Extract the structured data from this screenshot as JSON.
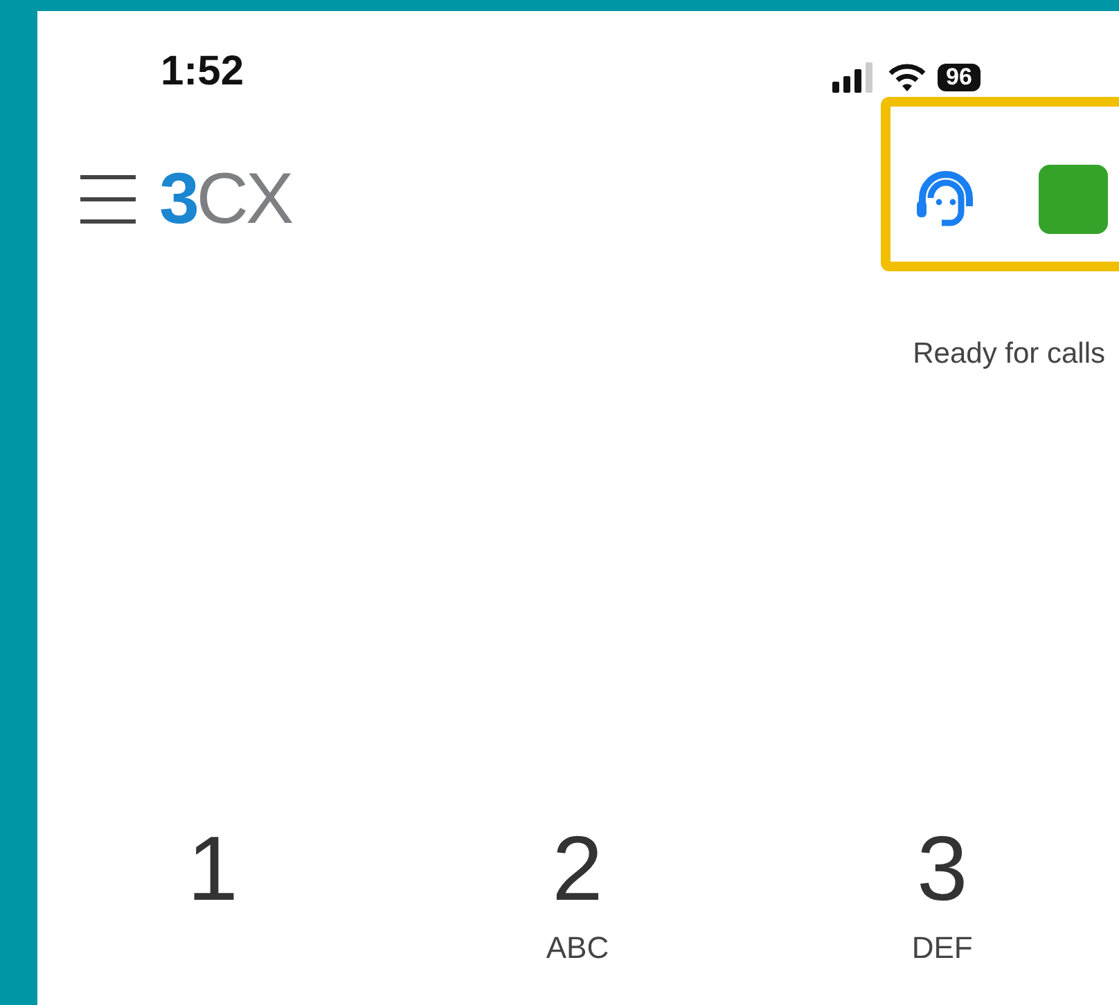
{
  "status_bar": {
    "time": "1:52",
    "battery": "96"
  },
  "header": {
    "logo": {
      "lead": "3",
      "rest": "CX"
    },
    "agent_status": {
      "label": "Ready for calls"
    }
  },
  "keypad": [
    {
      "digit": "1"
    },
    {
      "digit": "2",
      "letters": "ABC"
    },
    {
      "digit": "3",
      "letters": "DEF"
    }
  ]
}
